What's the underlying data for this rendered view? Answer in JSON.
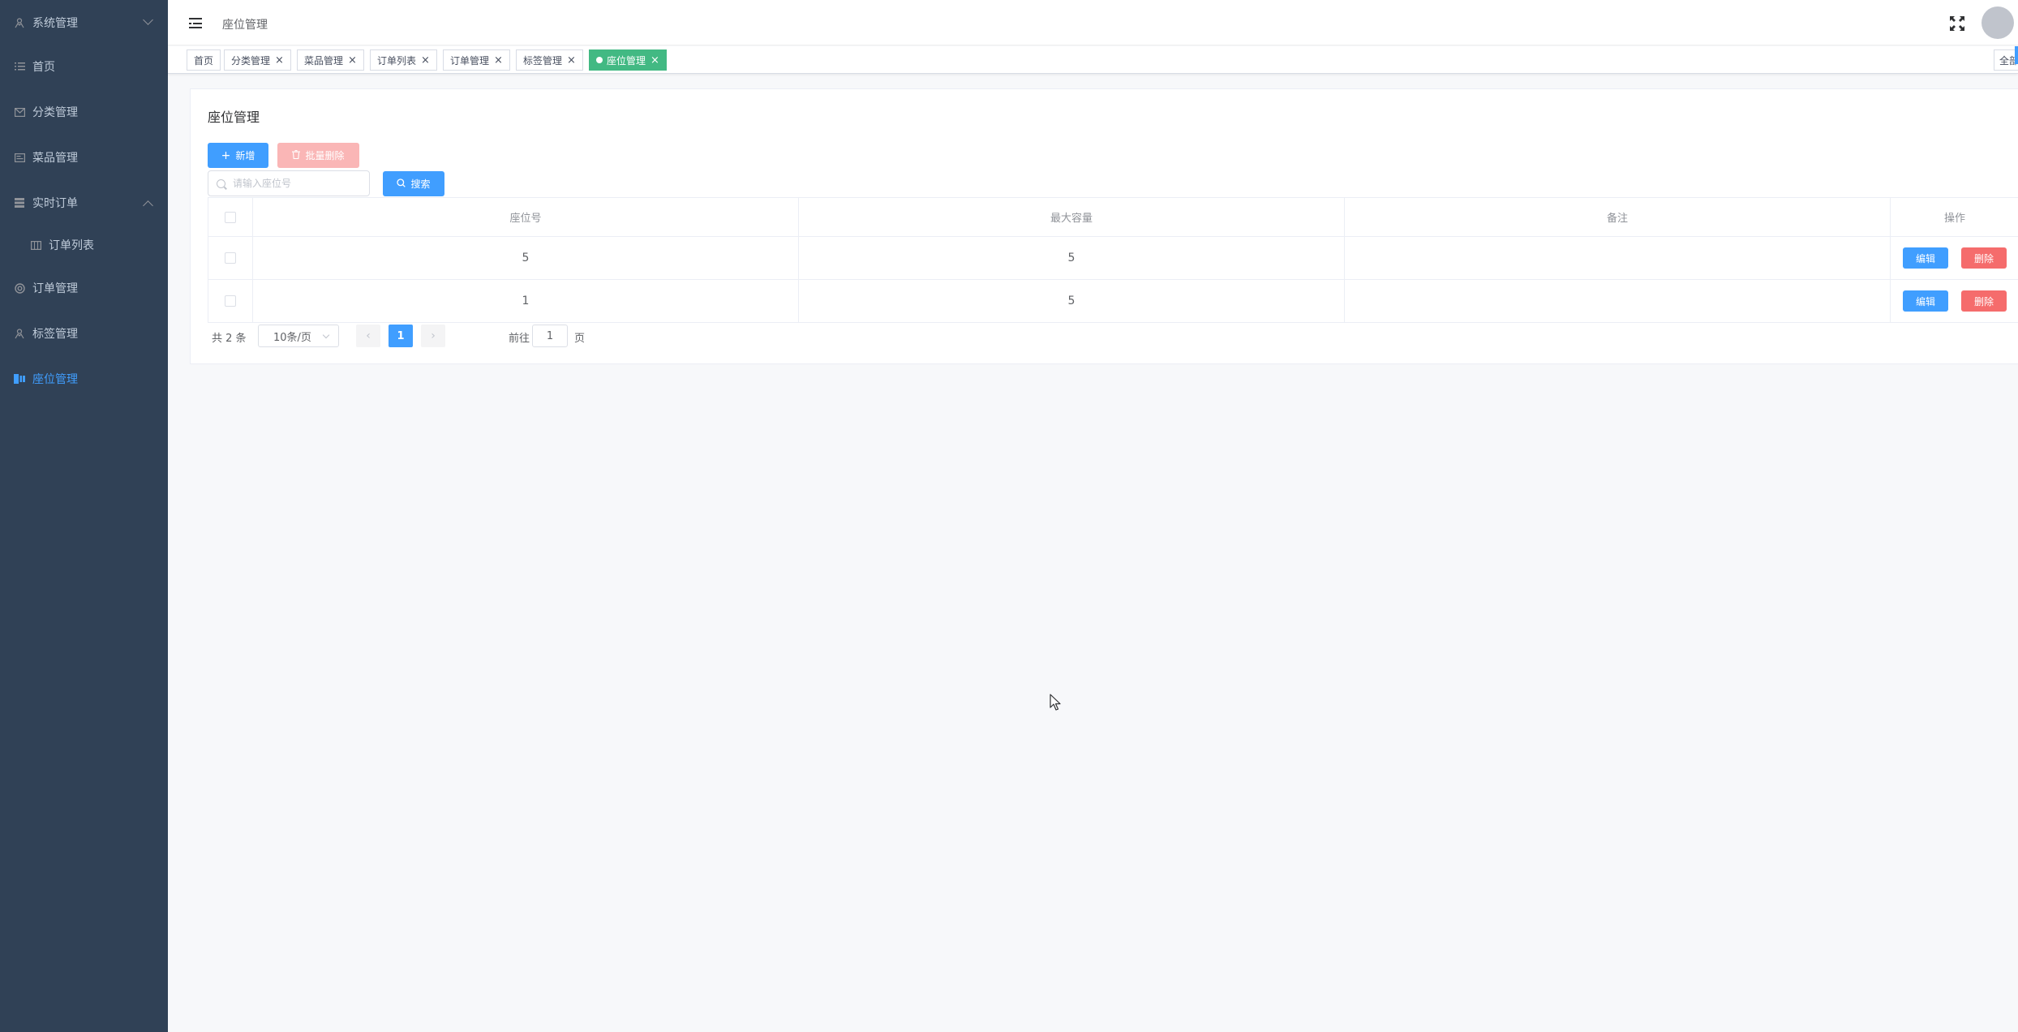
{
  "sidebar": {
    "items": [
      {
        "label": "系统管理",
        "icon": "user-icon",
        "arrow": "down"
      },
      {
        "label": "首页",
        "icon": "list-icon"
      },
      {
        "label": "分类管理",
        "icon": "message-icon"
      },
      {
        "label": "菜品管理",
        "icon": "card-icon"
      },
      {
        "label": "实时订单",
        "icon": "grid-icon",
        "arrow": "up"
      },
      {
        "label": "订单列表",
        "icon": "table-icon",
        "sub": true
      },
      {
        "label": "订单管理",
        "icon": "help-icon"
      },
      {
        "label": "标签管理",
        "icon": "user-icon"
      },
      {
        "label": "座位管理",
        "icon": "seat-icon",
        "active": true
      }
    ]
  },
  "header": {
    "breadcrumb": "座位管理"
  },
  "tags": [
    {
      "label": "首页",
      "closable": false
    },
    {
      "label": "分类管理",
      "closable": true
    },
    {
      "label": "菜品管理",
      "closable": true
    },
    {
      "label": "订单列表",
      "closable": true
    },
    {
      "label": "订单管理",
      "closable": true
    },
    {
      "label": "标签管理",
      "closable": true
    },
    {
      "label": "座位管理",
      "closable": true,
      "active": true
    }
  ],
  "tags_right_label": "全部",
  "tag_close_glyph": "×",
  "page": {
    "title": "座位管理",
    "add_label": "新增",
    "batch_delete_label": "批量删除",
    "search_placeholder": "请输入座位号",
    "search_label": "搜索"
  },
  "table": {
    "columns": [
      "座位号",
      "最大容量",
      "备注",
      "操作"
    ],
    "rows": [
      {
        "seat": "5",
        "capacity": "5",
        "remark": ""
      },
      {
        "seat": "1",
        "capacity": "5",
        "remark": ""
      }
    ],
    "edit_label": "编辑",
    "delete_label": "删除"
  },
  "pagination": {
    "total_text": "共 2 条",
    "page_size": "10条/页",
    "current_page": "1",
    "goto_label": "前往",
    "goto_value": "1",
    "goto_suffix": "页",
    "prev_glyph": "‹",
    "next_glyph": "›"
  },
  "colors": {
    "sidebar_bg": "#304156",
    "primary": "#409eff",
    "tag_active": "#42b983",
    "danger": "#f56c6c"
  }
}
